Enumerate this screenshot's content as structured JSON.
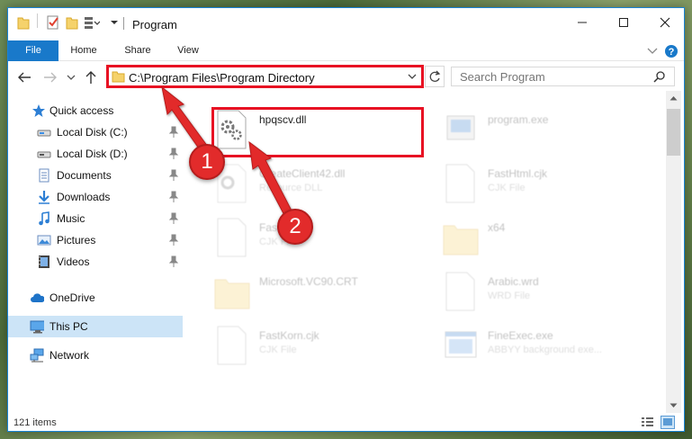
{
  "window": {
    "title": "Program",
    "controls": [
      "minimize-icon",
      "maximize-icon",
      "close-icon"
    ]
  },
  "ribbon": {
    "tabs": [
      "File",
      "Home",
      "Share",
      "View"
    ]
  },
  "address": {
    "path": "C:\\Program Files\\Program Directory",
    "search_placeholder": "Search Program"
  },
  "nav": {
    "items": [
      {
        "label": "Quick access",
        "icon": "star-icon"
      },
      {
        "label": "Local Disk (C:)",
        "icon": "drive-icon",
        "pinned": true
      },
      {
        "label": "Local Disk (D:)",
        "icon": "drive-icon",
        "pinned": true
      },
      {
        "label": "Documents",
        "icon": "documents-icon",
        "pinned": true
      },
      {
        "label": "Downloads",
        "icon": "download-icon",
        "pinned": true
      },
      {
        "label": "Music",
        "icon": "music-icon",
        "pinned": true
      },
      {
        "label": "Pictures",
        "icon": "pictures-icon",
        "pinned": true
      },
      {
        "label": "Videos",
        "icon": "videos-icon",
        "pinned": true
      },
      {
        "label": "OneDrive",
        "icon": "cloud-icon"
      },
      {
        "label": "This PC",
        "icon": "computer-icon",
        "selected": true
      },
      {
        "label": "Network",
        "icon": "network-icon"
      }
    ]
  },
  "files": [
    {
      "name": "hpqscv.dll",
      "type": "",
      "icon": "dll-gear-icon",
      "highlighted": true
    },
    {
      "name": "program.exe",
      "type": "",
      "icon": "exe-icon"
    },
    {
      "name": "CreateClient42.dll",
      "type": "Resource DLL",
      "icon": "dll-gear-icon"
    },
    {
      "name": "FastHtml.cjk",
      "type": "CJK File",
      "icon": "file-icon"
    },
    {
      "name": "FastHtml",
      "type": "CJK File",
      "icon": "file-icon"
    },
    {
      "name": "x64",
      "type": "",
      "icon": "folder-icon"
    },
    {
      "name": "Microsoft.VC90.CRT",
      "type": "",
      "icon": "folder-icon"
    },
    {
      "name": "Arabic.wrd",
      "type": "WRD File",
      "icon": "file-icon"
    },
    {
      "name": "FastKorn.cjk",
      "type": "CJK File",
      "icon": "file-icon"
    },
    {
      "name": "FineExec.exe",
      "type": "ABBYY background exe...",
      "icon": "exe-window-icon"
    }
  ],
  "status": {
    "item_count": "121 items"
  },
  "annotations": {
    "step1": "1",
    "step2": "2"
  },
  "colors": {
    "accent": "#1979ca",
    "highlight": "#e81123",
    "callout": "#e22b2b"
  }
}
